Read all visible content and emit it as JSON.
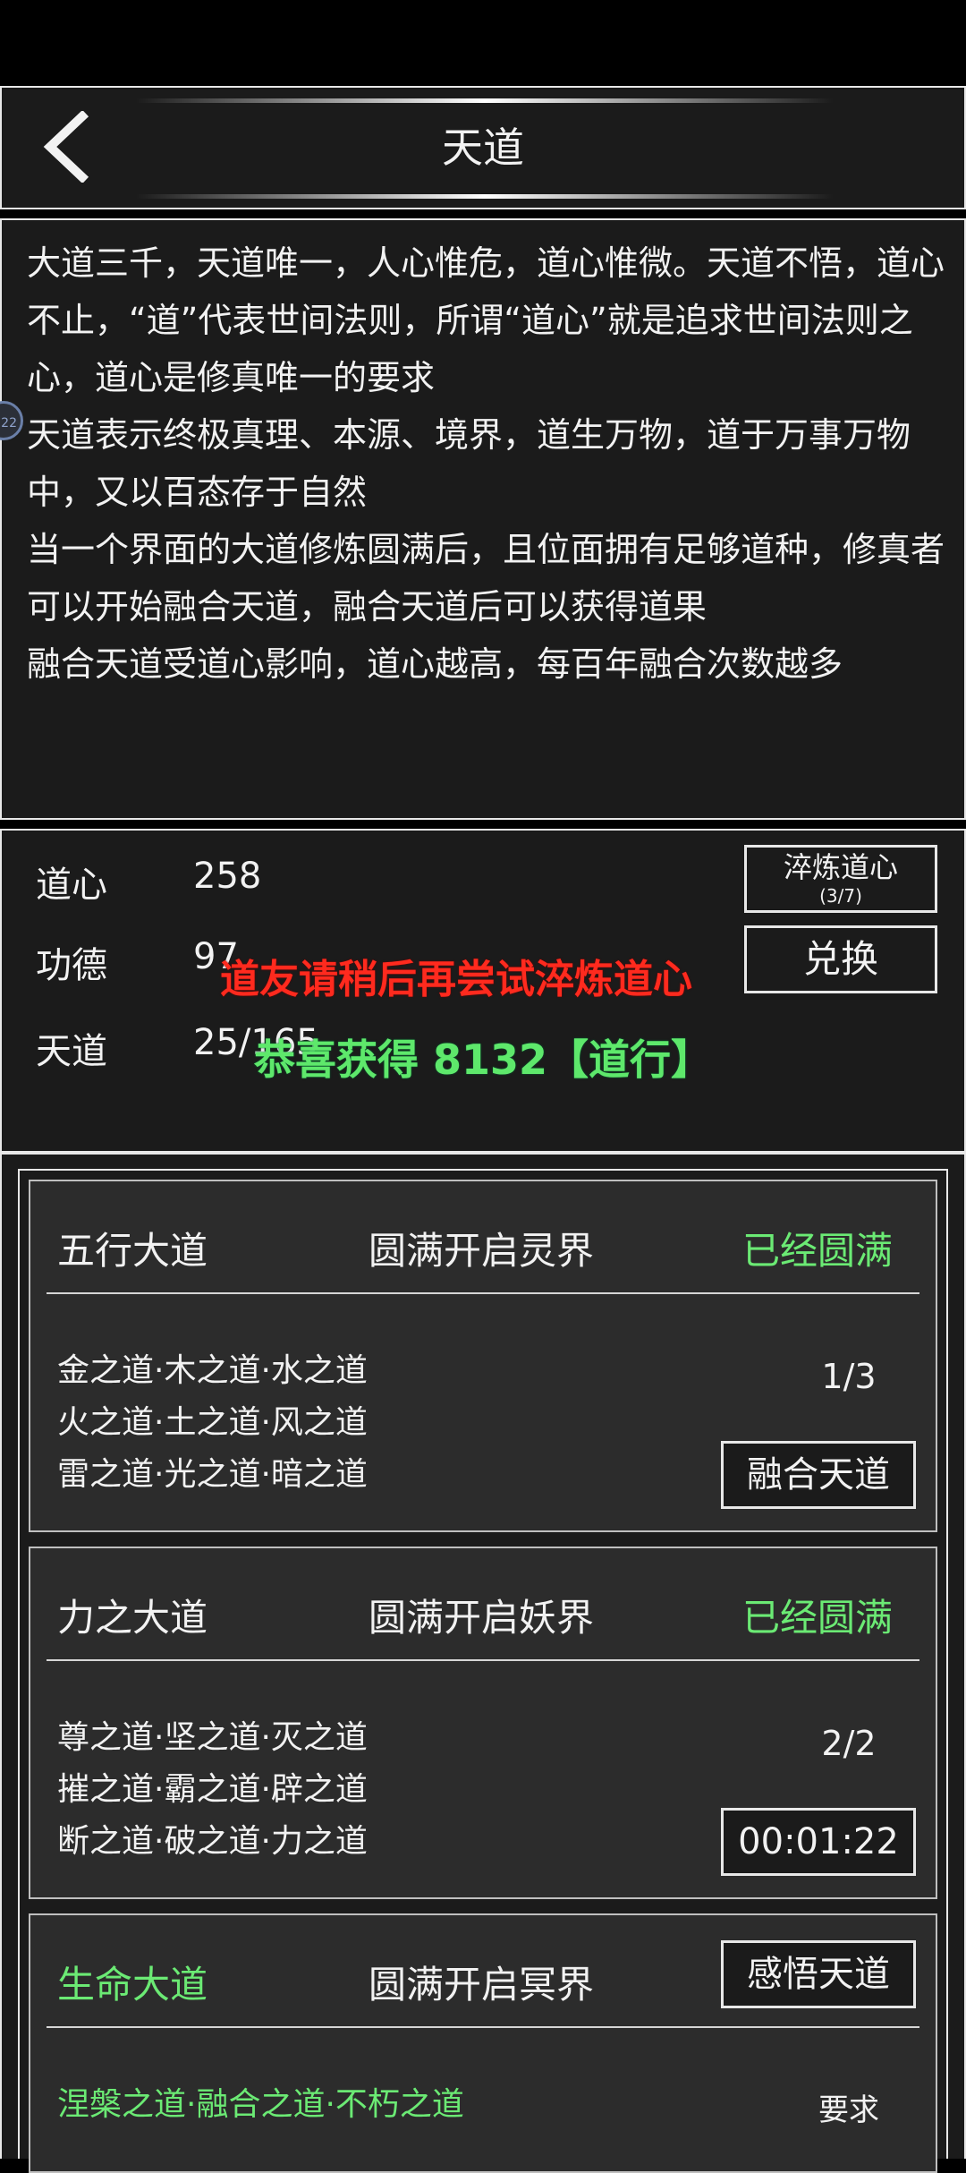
{
  "header": {
    "title": "天道"
  },
  "description": [
    "大道三千，天道唯一，人心惟危，道心惟微。天道不悟，道心不止，“道”代表世间法则，所谓“道心”就是追求世间法则之心，道心是修真唯一的要求",
    "天道表示终极真理、本源、境界，道生万物，道于万事万物中，又以百态存于自然",
    "当一个界面的大道修炼圆满后，且位面拥有足够道种，修真者可以开始融合天道，融合天道后可以获得道果",
    "融合天道受道心影响，道心越高，每百年融合次数越多"
  ],
  "side_dot_label": "22",
  "stats": {
    "daoxin_label": "道心",
    "daoxin_value": "258",
    "gongde_label": "功德",
    "gongde_value": "97",
    "tiandao_label": "天道",
    "tiandao_value": "25/165"
  },
  "buttons": {
    "temper_label": "淬炼道心",
    "temper_count": "(3/7)",
    "exchange_label": "兑换"
  },
  "toasts": {
    "red": "道友请稍后再尝试淬炼道心",
    "green": "恭喜获得 8132【道行】"
  },
  "cards": [
    {
      "name": "五行大道",
      "requirement": "圆满开启灵界",
      "status": "已经圆满",
      "lines": [
        "金之道·木之道·水之道",
        "火之道·土之道·风之道",
        "雷之道·光之道·暗之道"
      ],
      "count": "1/3",
      "action": "融合天道"
    },
    {
      "name": "力之大道",
      "requirement": "圆满开启妖界",
      "status": "已经圆满",
      "lines": [
        "尊之道·坚之道·灭之道",
        "摧之道·霸之道·辟之道",
        "断之道·破之道·力之道"
      ],
      "count": "2/2",
      "action": "00:01:22"
    },
    {
      "name": "生命大道",
      "requirement": "圆满开启冥界",
      "action": "感悟天道",
      "lines": [
        "涅槃之道·融合之道·不朽之道"
      ],
      "extra": "要求"
    }
  ],
  "colors": {
    "accent_green": "#6bea74",
    "toast_red": "#ff2a1e",
    "panel_bg": "#1b1b1b",
    "card_bg": "#2c2c2c"
  }
}
